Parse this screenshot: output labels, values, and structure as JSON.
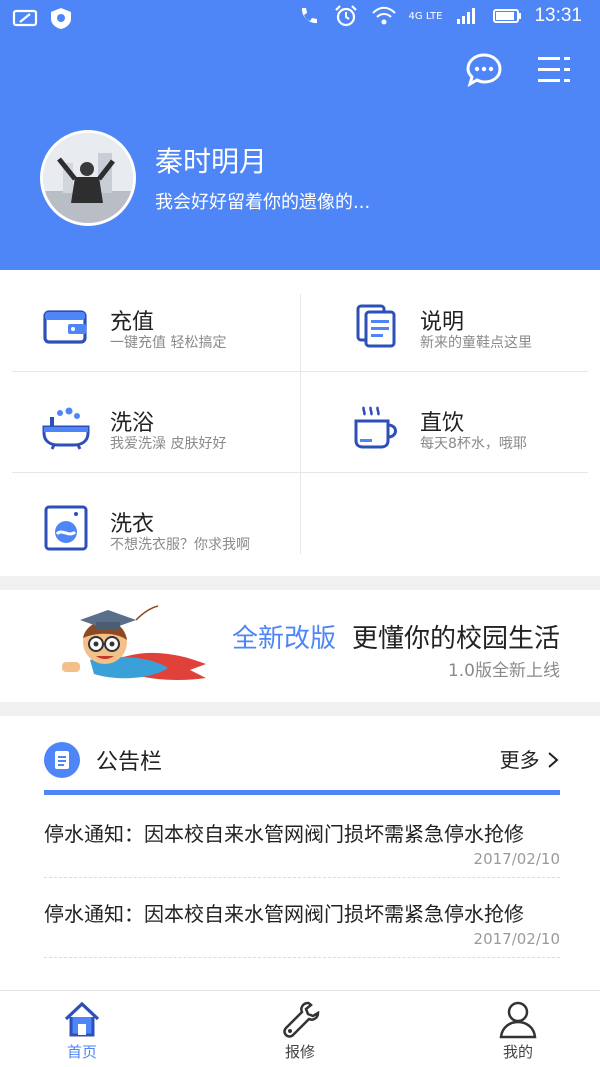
{
  "status_bar": {
    "network": "4G LTE",
    "time": "13:31"
  },
  "profile": {
    "name": "秦时明月",
    "signature": "我会好好留着你的遗像的..."
  },
  "menu": [
    {
      "title": "充值",
      "subtitle": "一键充值 轻松搞定",
      "icon": "wallet-icon"
    },
    {
      "title": "说明",
      "subtitle": "新来的童鞋点这里",
      "icon": "document-icon"
    },
    {
      "title": "洗浴",
      "subtitle": "我爱洗澡 皮肤好好",
      "icon": "bathtub-icon"
    },
    {
      "title": "直饮",
      "subtitle": "每天8杯水，哦耶",
      "icon": "cup-icon"
    },
    {
      "title": "洗衣",
      "subtitle": "不想洗衣服？你求我啊",
      "icon": "washing-machine-icon"
    }
  ],
  "banner": {
    "highlight": "全新改版",
    "headline": "更懂你的校园生活",
    "sub": "1.0版全新上线"
  },
  "notices": {
    "title": "公告栏",
    "more": "更多",
    "items": [
      {
        "text": "停水通知：因本校自来水管网阀门损坏需紧急停水抢修",
        "date": "2017/02/10"
      },
      {
        "text": "停水通知：因本校自来水管网阀门损坏需紧急停水抢修",
        "date": "2017/02/10"
      }
    ]
  },
  "tabs": [
    {
      "label": "首页",
      "icon": "home-icon",
      "active": true
    },
    {
      "label": "报修",
      "icon": "wrench-icon",
      "active": false
    },
    {
      "label": "我的",
      "icon": "user-icon",
      "active": false
    }
  ],
  "colors": {
    "primary": "#4f86f7",
    "icon_dark": "#2d4fb8"
  }
}
